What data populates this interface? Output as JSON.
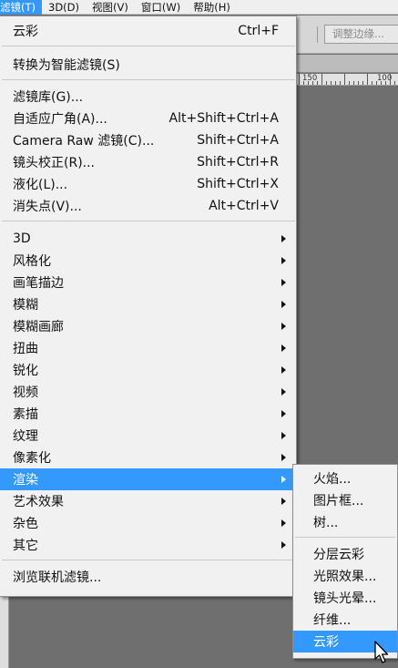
{
  "menubar": {
    "items": [
      "滤镜(T)",
      "3D(D)",
      "视图(V)",
      "窗口(W)",
      "帮助(H)"
    ]
  },
  "options_bar": {
    "refine_edge_label": "调整边缘..."
  },
  "ruler": {
    "labels": [
      "150",
      "100"
    ]
  },
  "filter_menu": {
    "last_filter": {
      "label": "云彩",
      "shortcut": "Ctrl+F"
    },
    "convert_smart": {
      "label": "转换为智能滤镜(S)"
    },
    "gallery": {
      "label": "滤镜库(G)..."
    },
    "adaptive_wide": {
      "label": "自适应广角(A)...",
      "shortcut": "Alt+Shift+Ctrl+A"
    },
    "camera_raw": {
      "label": "Camera Raw 滤镜(C)...",
      "shortcut": "Shift+Ctrl+A"
    },
    "lens_correction": {
      "label": "镜头校正(R)...",
      "shortcut": "Shift+Ctrl+R"
    },
    "liquify": {
      "label": "液化(L)...",
      "shortcut": "Shift+Ctrl+X"
    },
    "vanishing_point": {
      "label": "消失点(V)...",
      "shortcut": "Alt+Ctrl+V"
    },
    "groups": [
      "3D",
      "风格化",
      "画笔描边",
      "模糊",
      "模糊画廊",
      "扭曲",
      "锐化",
      "视频",
      "素描",
      "纹理",
      "像素化",
      "渲染",
      "艺术效果",
      "杂色",
      "其它"
    ],
    "browse_online": {
      "label": "浏览联机滤镜..."
    }
  },
  "render_submenu": {
    "items": [
      "火焰...",
      "图片框...",
      "树...",
      "分层云彩",
      "光照效果...",
      "镜头光晕...",
      "纤维...",
      "云彩"
    ]
  },
  "colors": {
    "highlight": "#3399ff"
  }
}
